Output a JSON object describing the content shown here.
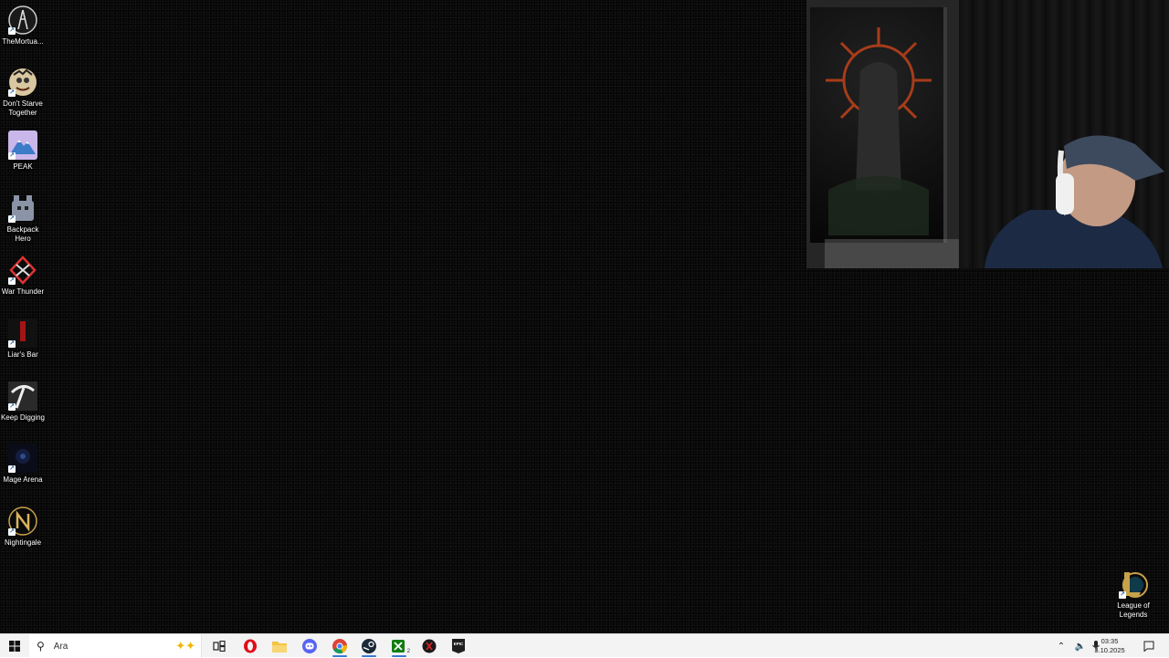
{
  "desktop": {
    "icons": [
      {
        "label": "TheMortua...",
        "icon": "mortuary-assistant-icon"
      },
      {
        "label": "Don't Starve Together",
        "icon": "dont-starve-together-icon"
      },
      {
        "label": "PEAK",
        "icon": "peak-icon"
      },
      {
        "label": "Backpack Hero",
        "icon": "backpack-hero-icon"
      },
      {
        "label": "War Thunder",
        "icon": "war-thunder-icon"
      },
      {
        "label": "Liar's Bar",
        "icon": "liars-bar-icon"
      },
      {
        "label": "Keep Digging",
        "icon": "keep-digging-icon"
      },
      {
        "label": "Mage Arena",
        "icon": "mage-arena-icon"
      },
      {
        "label": "Nightingale",
        "icon": "nightingale-icon"
      }
    ],
    "corner_icon": {
      "label": "League of Legends",
      "icon": "league-of-legends-icon"
    }
  },
  "taskbar": {
    "search_placeholder": "Ara",
    "apps": [
      {
        "name": "task-view",
        "icon": "task-view-icon"
      },
      {
        "name": "opera",
        "icon": "opera-icon"
      },
      {
        "name": "file-explorer",
        "icon": "folder-icon"
      },
      {
        "name": "discord",
        "icon": "discord-icon"
      },
      {
        "name": "chrome",
        "icon": "chrome-icon"
      },
      {
        "name": "steam",
        "icon": "steam-icon"
      },
      {
        "name": "xbox",
        "icon": "xbox-icon",
        "badge": "2"
      },
      {
        "name": "app-red",
        "icon": "red-app-icon"
      },
      {
        "name": "epic-games",
        "icon": "epic-games-icon",
        "text": "EPIC"
      }
    ],
    "clock": {
      "time": "03:35",
      "date": "3.10.2025"
    }
  },
  "colors": {
    "desktop_bg": "#050505",
    "taskbar_bg": "#f3f3f3",
    "accent": "#3a7bd5"
  }
}
